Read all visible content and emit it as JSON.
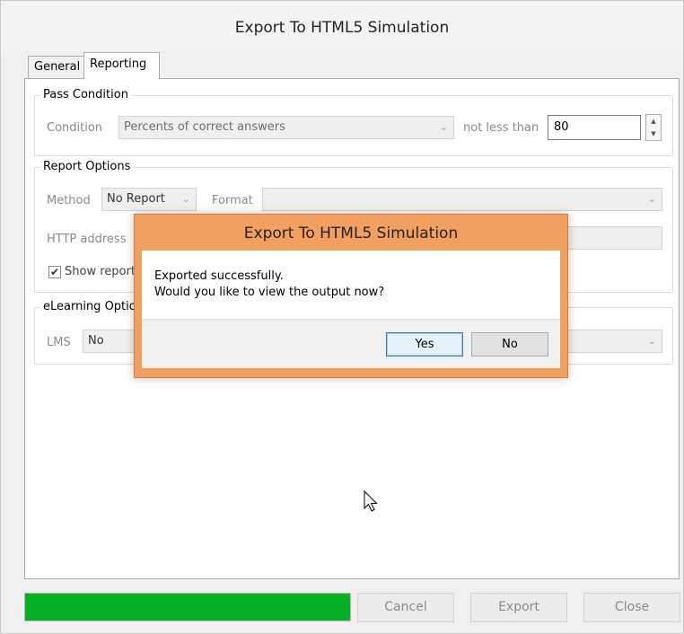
{
  "window": {
    "title": "Export To HTML5 Simulation"
  },
  "tabs": [
    {
      "label": "General"
    },
    {
      "label": "Reporting",
      "active": true
    }
  ],
  "pass_condition": {
    "group_label": "Pass Condition",
    "condition_label": "Condition",
    "condition_value": "Percents of correct answers",
    "threshold_label": "not less than",
    "threshold_value": "80"
  },
  "report_options": {
    "group_label": "Report Options",
    "method_label": "Method",
    "method_value": "No Report",
    "format_label": "Format",
    "format_value": "",
    "http_label": "HTTP address",
    "show_report_label": "Show report",
    "show_report_checked": true
  },
  "elearning": {
    "group_label": "eLearning Options",
    "lms_label": "LMS",
    "lms_value": "No"
  },
  "dialog": {
    "title": "Export To HTML5 Simulation",
    "message_line1": "Exported successfully.",
    "message_line2": "Would you like to view the output now?",
    "yes_label": "Yes",
    "no_label": "No"
  },
  "footer": {
    "progress": 1.0,
    "cancel_label": "Cancel",
    "export_label": "Export",
    "close_label": "Close"
  },
  "colors": {
    "progress_fill": "#06b025",
    "dialog_frame": "#f2a060"
  }
}
